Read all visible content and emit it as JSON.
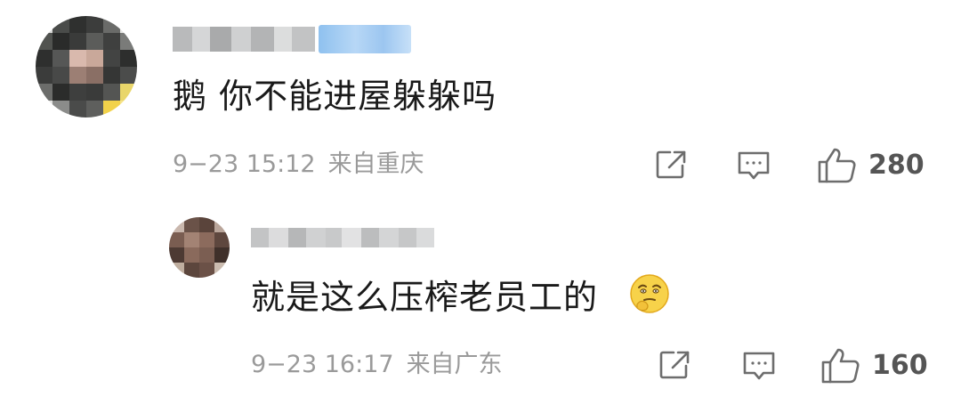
{
  "comments": [
    {
      "content": "鹅 你不能进屋躲躲吗",
      "time": "9−23 15:12",
      "location": "来自重庆",
      "likes": "280"
    },
    {
      "content": "就是这么压榨老员工的",
      "emoji": "thinking-face-emoji",
      "time": "9−23 16:17",
      "location": "来自广东",
      "likes": "160"
    }
  ],
  "icons": {
    "share": "share-icon",
    "comment": "comment-icon",
    "like": "thumbs-up-icon"
  },
  "colors": {
    "text": "#1a1a1a",
    "meta": "#9a9a9a",
    "icon": "#6d6d6d",
    "badge": "#9cc6f0"
  }
}
